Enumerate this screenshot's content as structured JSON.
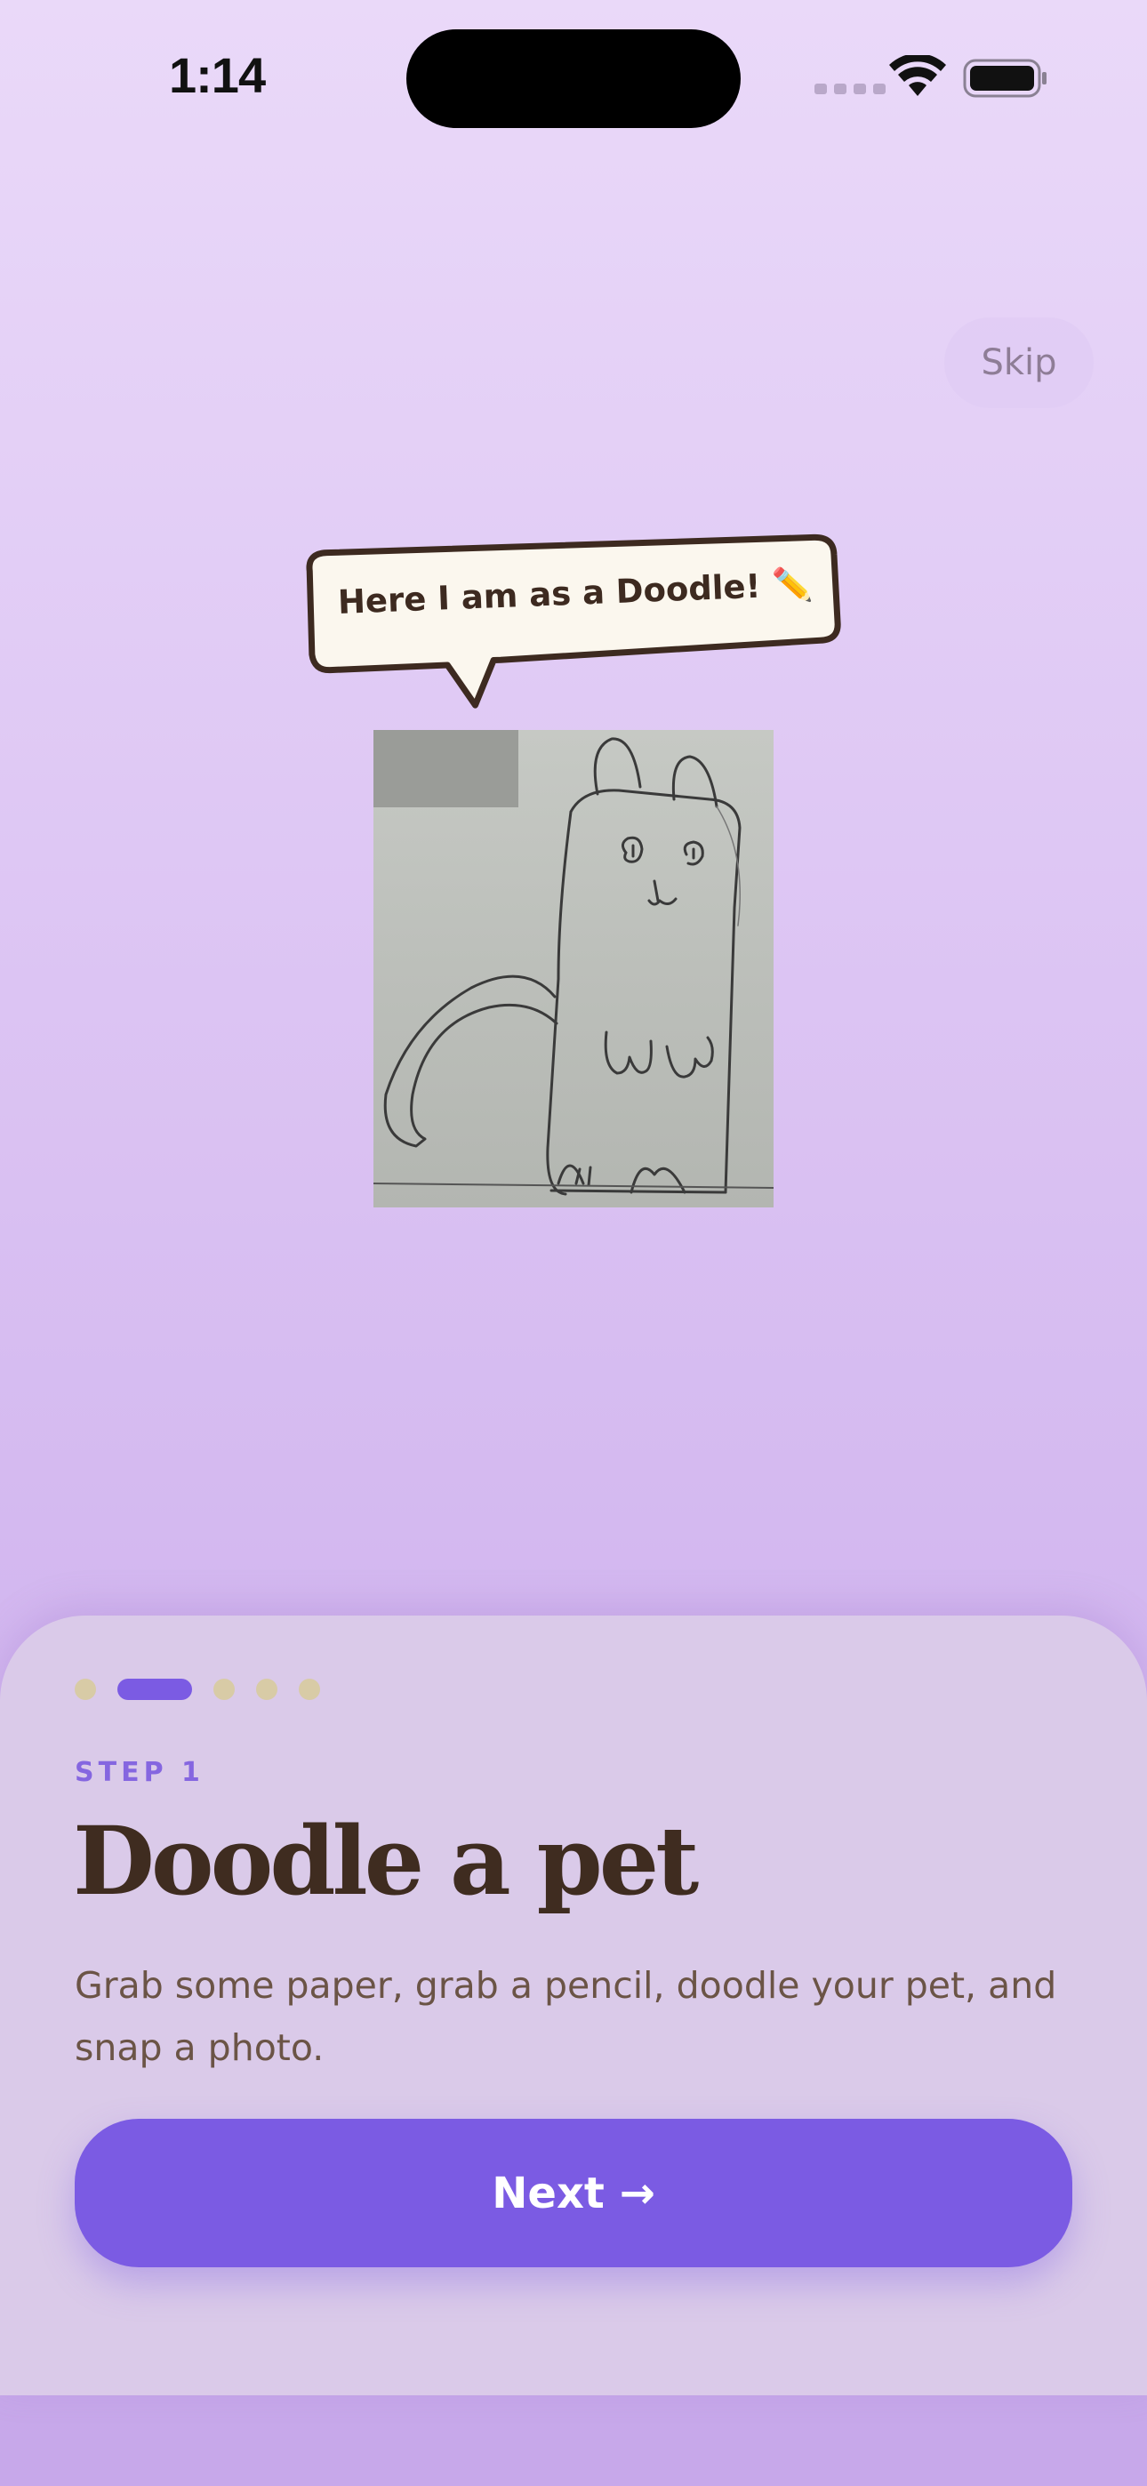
{
  "status_bar": {
    "time": "1:14"
  },
  "header": {
    "skip_label": "Skip"
  },
  "illustration": {
    "speech_bubble_text": "Here I am as a Doodle! ✏️"
  },
  "onboarding": {
    "step_label": "STEP 1",
    "title": "Doodle a pet",
    "description": "Grab some paper, grab a pencil, doodle your pet, and snap a photo.",
    "next_label": "Next →",
    "total_steps": 5,
    "current_step": 2
  },
  "colors": {
    "accent": "#7b5be3",
    "title_text": "#3f2c20",
    "body_text": "#6b5446",
    "inactive_dot": "#d8cba6",
    "card_background": "#dacae9"
  },
  "icons": [
    "wifi-icon",
    "battery-icon",
    "pencil-emoji"
  ]
}
